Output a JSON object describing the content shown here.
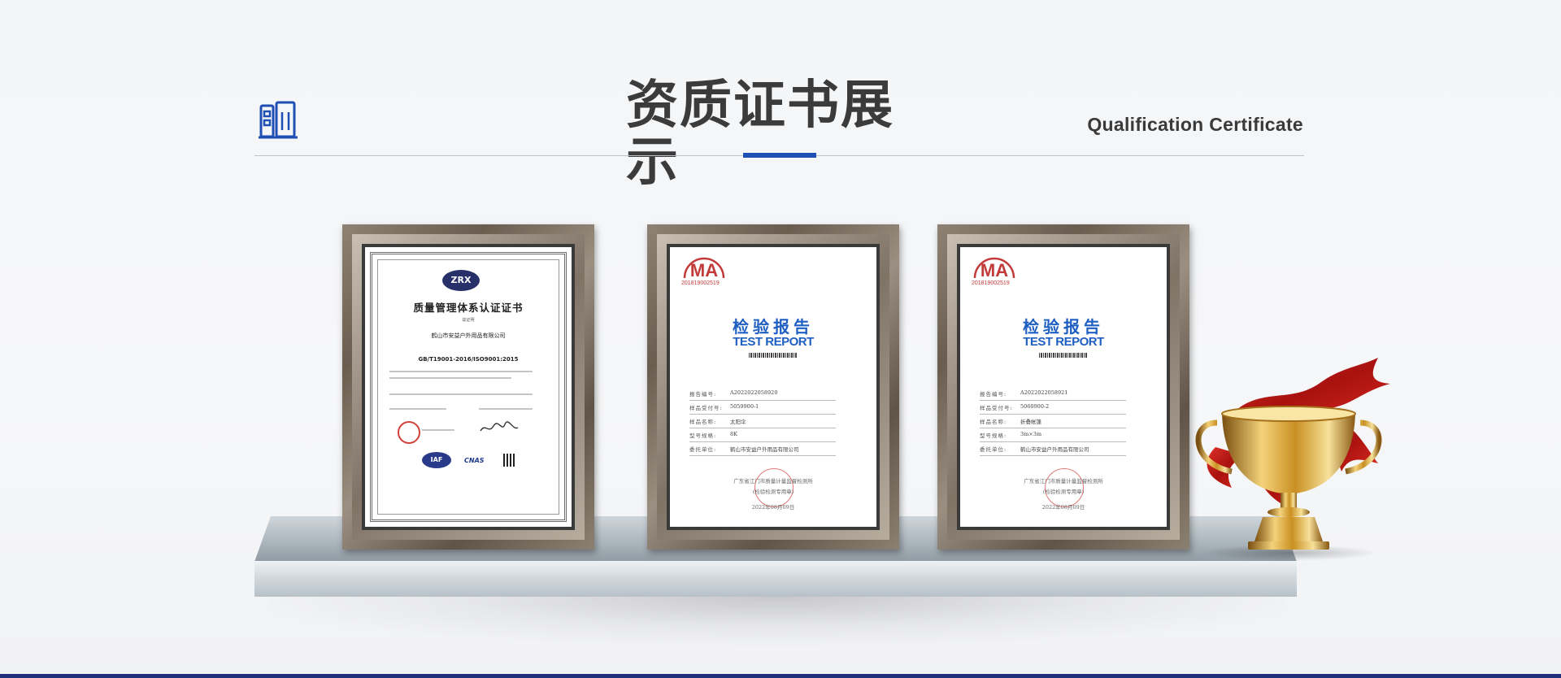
{
  "section": {
    "title_cn": "资质证书展示",
    "title_en": "Qualification Certificate",
    "icon": "building-icon",
    "accent_color": "#1f4fb4"
  },
  "certificates": [
    {
      "type": "iso-certificate",
      "logo": "ZRX",
      "title": "质量管理体系认证证书",
      "subtitle": "兹证明",
      "company": "鹤山市安益户外用品有限公司",
      "standard": "GB/T19001-2016/ISO9001:2015",
      "marks": [
        "IAF",
        "CNAS"
      ]
    },
    {
      "type": "test-report",
      "ma_mark": "MA",
      "ma_number": "201819002519",
      "title_cn": "检验报告",
      "title_en": "TEST REPORT",
      "rows": [
        {
          "key": "报告编号:",
          "value": "A2022022058920"
        },
        {
          "key": "样品受付号:",
          "value": "5059900-1"
        },
        {
          "key": "样品名称:",
          "value": "太阳伞"
        },
        {
          "key": "型号规格:",
          "value": "8K"
        },
        {
          "key": "委托单位:",
          "value": "鹤山市安益户外用品有限公司"
        }
      ],
      "footer_1": "广东省江门市质量计量监督检测所",
      "footer_2": "(检验检测专用章)",
      "date": "2022年08月09日"
    },
    {
      "type": "test-report",
      "ma_mark": "MA",
      "ma_number": "201819002519",
      "title_cn": "检验报告",
      "title_en": "TEST REPORT",
      "rows": [
        {
          "key": "报告编号:",
          "value": "A2022022058921"
        },
        {
          "key": "样品受付号:",
          "value": "5060900-2"
        },
        {
          "key": "样品名称:",
          "value": "折叠帐篷"
        },
        {
          "key": "型号规格:",
          "value": "3m×3m"
        },
        {
          "key": "委托单位:",
          "value": "鹤山市安益户外用品有限公司"
        }
      ],
      "footer_1": "广东省江门市质量计量监督检测所",
      "footer_2": "(检验检测专用章)",
      "date": "2022年08月09日"
    }
  ]
}
